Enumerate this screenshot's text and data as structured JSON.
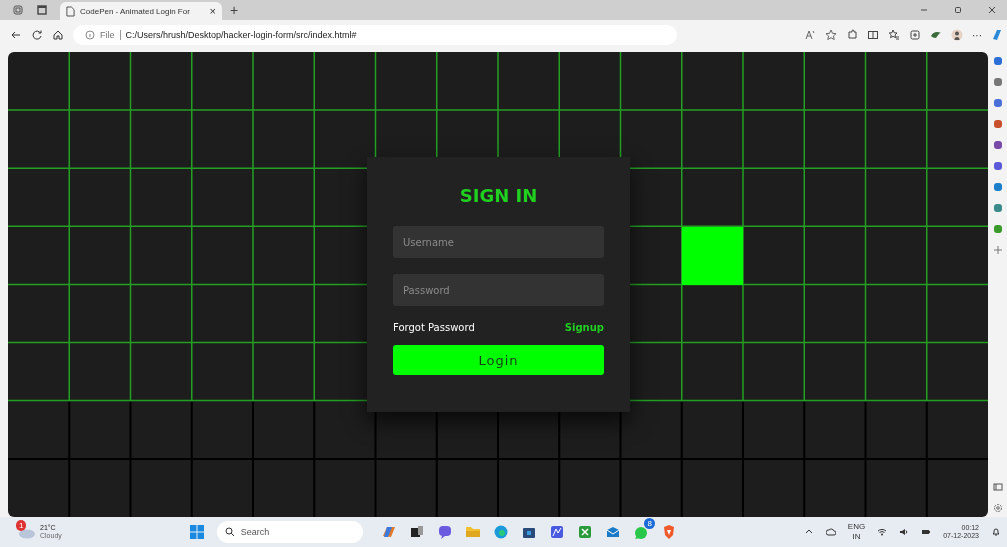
{
  "browser": {
    "tab": {
      "title": "CodePen - Animated Login For",
      "close": "×"
    },
    "new_tab": "+",
    "address": {
      "scheme": "File",
      "url": "C:/Users/hrush/Desktop/hacker-login-form/src/index.html#"
    },
    "more": "···"
  },
  "login": {
    "title": "SIGN IN",
    "fields": [
      {
        "placeholder": "Username"
      },
      {
        "placeholder": "Password"
      }
    ],
    "forgot": "Forgot Password",
    "signup": "Signup",
    "button": "Login"
  },
  "taskbar": {
    "weather": {
      "temp": "21°C",
      "condition": "Cloudy",
      "badge": "1"
    },
    "search": {
      "placeholder": "Search"
    },
    "whatsapp_badge": "8",
    "tray": {
      "lang": "ENG",
      "region": "IN",
      "time": "00:12",
      "date": "07-12-2023"
    }
  }
}
